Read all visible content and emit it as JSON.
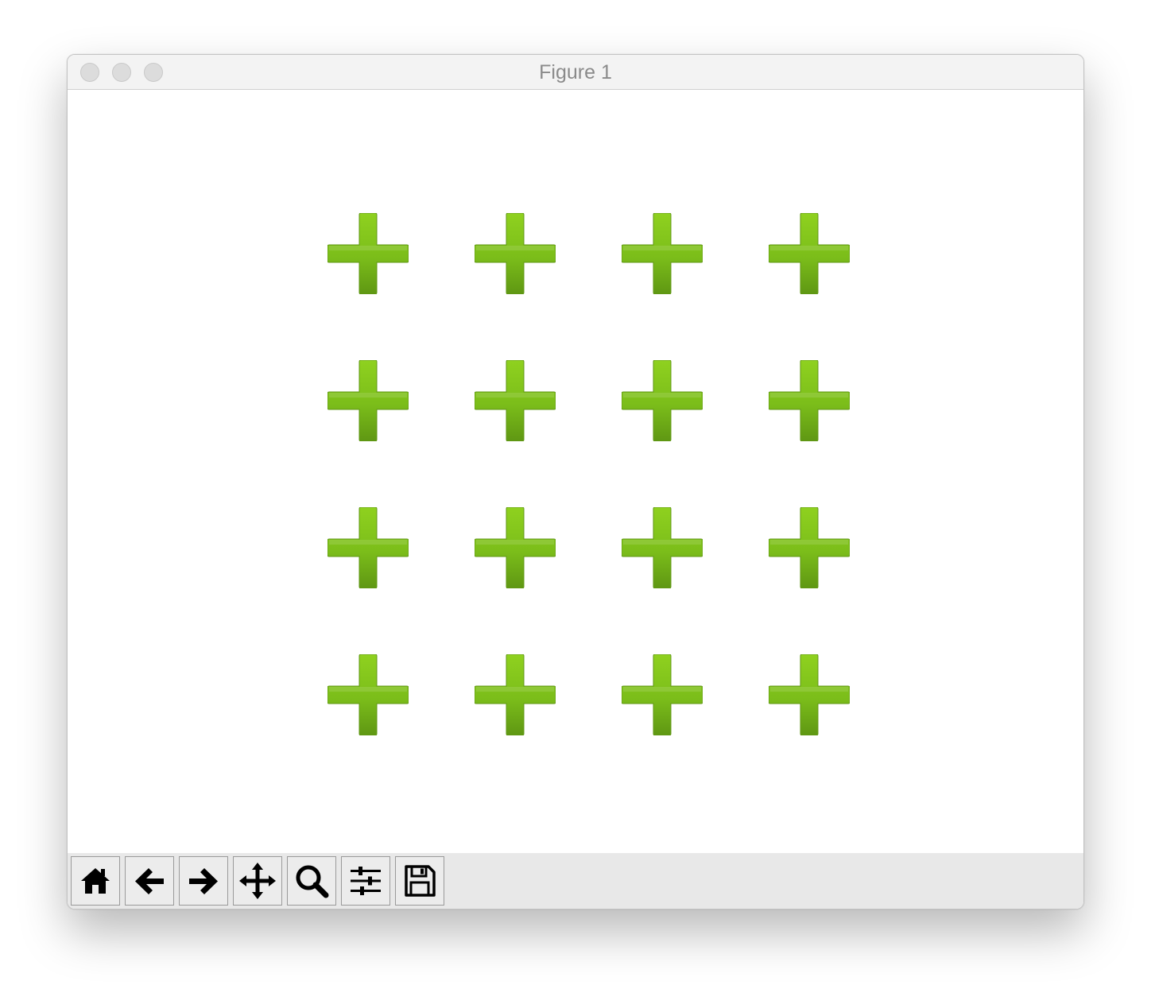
{
  "window": {
    "title": "Figure 1"
  },
  "figure": {
    "marker": "plus-marker-green",
    "rows": 4,
    "columns": 4,
    "colors": {
      "light": "#8fd11f",
      "mid": "#7bbd1a",
      "dark": "#5f9713"
    }
  },
  "toolbar": {
    "buttons": [
      {
        "name": "home-button",
        "icon": "home-icon"
      },
      {
        "name": "back-button",
        "icon": "arrow-left-icon"
      },
      {
        "name": "forward-button",
        "icon": "arrow-right-icon"
      },
      {
        "name": "pan-button",
        "icon": "move-icon"
      },
      {
        "name": "zoom-button",
        "icon": "search-icon"
      },
      {
        "name": "configure-subplots-button",
        "icon": "sliders-icon"
      },
      {
        "name": "save-button",
        "icon": "floppy-disk-icon"
      }
    ]
  }
}
